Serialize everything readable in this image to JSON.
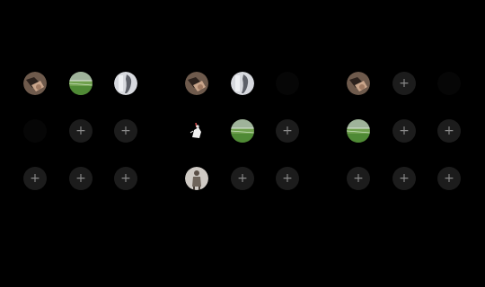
{
  "add_glyph": "+",
  "colors": {
    "background": "#000000",
    "add_slot": "#1c1c1c",
    "add_glyph": "#8a8a8a"
  },
  "panels": [
    {
      "slots": [
        [
          "photo-hands",
          "photo-soccer-field",
          "photo-statue"
        ],
        [
          "empty",
          "add",
          "add"
        ],
        [
          "add",
          "add",
          "add"
        ]
      ]
    },
    {
      "slots": [
        [
          "photo-hands",
          "photo-statue",
          "empty"
        ],
        [
          "photo-figure-sketch",
          "photo-soccer-field",
          "add"
        ],
        [
          "photo-person-standing",
          "add",
          "add"
        ]
      ]
    },
    {
      "slots": [
        [
          "photo-hands",
          "add",
          "empty"
        ],
        [
          "photo-soccer-field",
          "add",
          "add"
        ],
        [
          "add",
          "add",
          "add"
        ]
      ]
    }
  ]
}
